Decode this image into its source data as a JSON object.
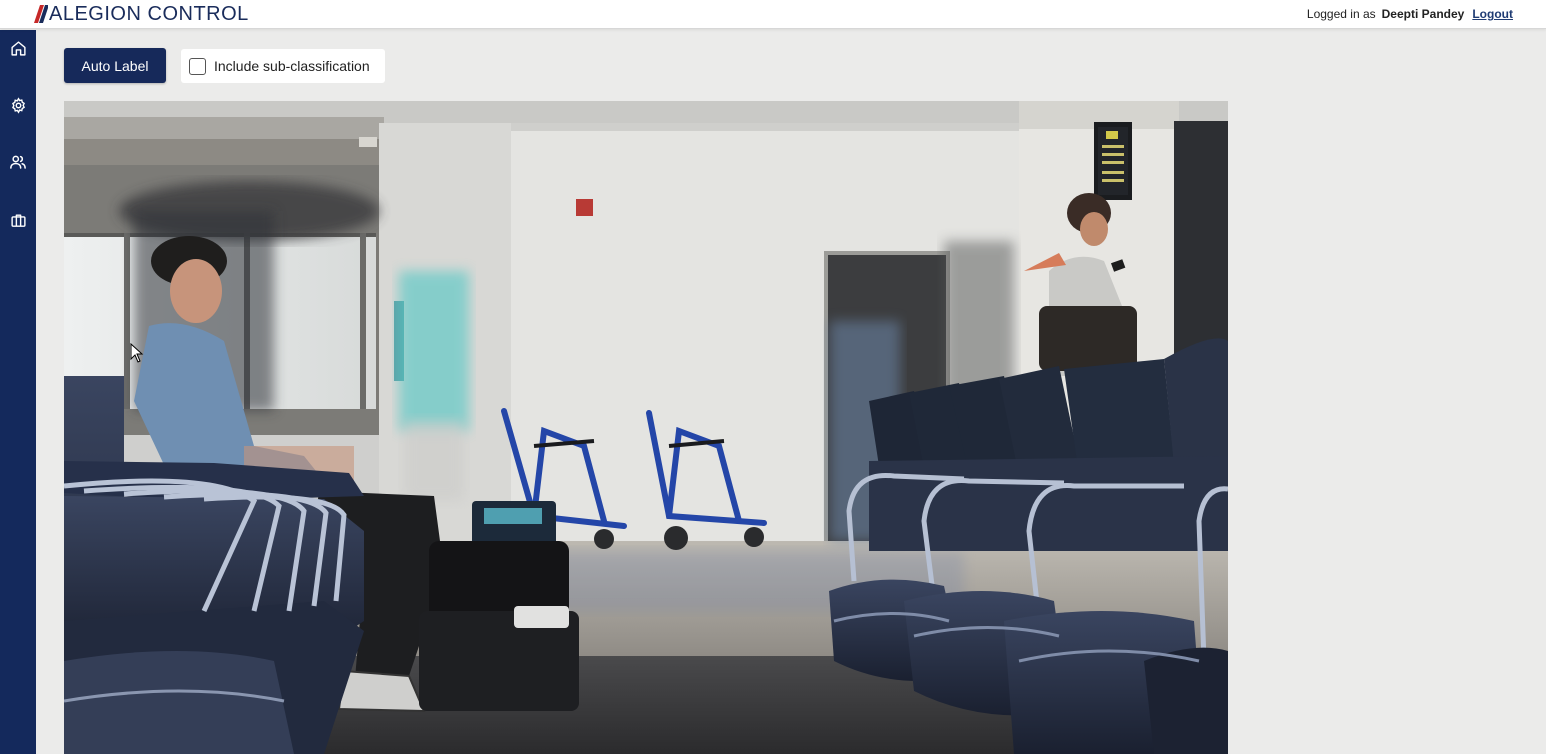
{
  "app": {
    "brand_prefix": "ALEGION ",
    "brand_c": "C",
    "brand_o": "O",
    "brand_suffix": "NTROL",
    "brand_color": "#1a2c5b"
  },
  "header": {
    "logged_in_prefix": "Logged in as",
    "user_name": "Deepti Pandey",
    "logout_label": "Logout"
  },
  "sidebar": {
    "background": "#14295c",
    "items": [
      {
        "icon": "home-icon"
      },
      {
        "icon": "gear-icon"
      },
      {
        "icon": "users-icon"
      },
      {
        "icon": "briefcase-icon"
      }
    ]
  },
  "toolbar": {
    "auto_label_button": "Auto Label",
    "include_subclassification_label": "Include sub-classification",
    "include_subclassification_checked": false
  },
  "image": {
    "description_icon": "airport-waiting-area-photo",
    "sign_text": [
      "Additional",
      "Restrooms",
      "Gates",
      "E1 - E2"
    ]
  }
}
